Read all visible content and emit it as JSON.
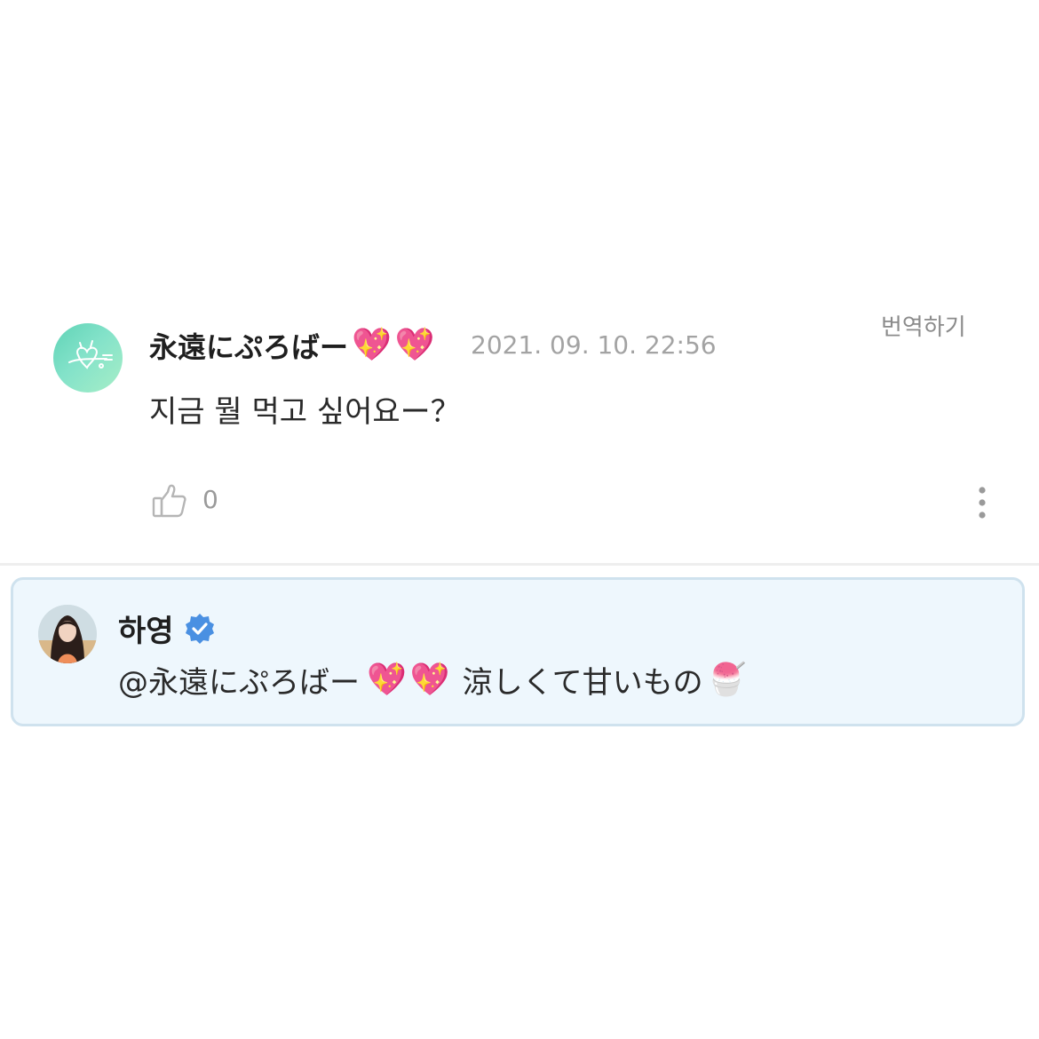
{
  "comment": {
    "username": "永遠にぷろばー",
    "emoji_1": "💖",
    "emoji_2": "💖",
    "timestamp": "2021. 09. 10. 22:56",
    "translate_label": "번역하기",
    "text": "지금 뭘 먹고 싶어요ー？",
    "like_count": "0",
    "icons": [
      "thumbs-up-icon",
      "more-vertical-icon"
    ]
  },
  "reply": {
    "username": "하영",
    "mention": "@永遠にぷろばー",
    "emoji_1": "💖",
    "emoji_2": "💖",
    "message": "涼しくて甘いもの",
    "message_emoji": "🍧",
    "icons": [
      "verified-badge-icon"
    ]
  },
  "colors": {
    "reply_background": "#eef7fd",
    "reply_border": "#cfe2ee",
    "verified_badge": "#4a90e2",
    "timestamp": "#a3a3a3"
  }
}
